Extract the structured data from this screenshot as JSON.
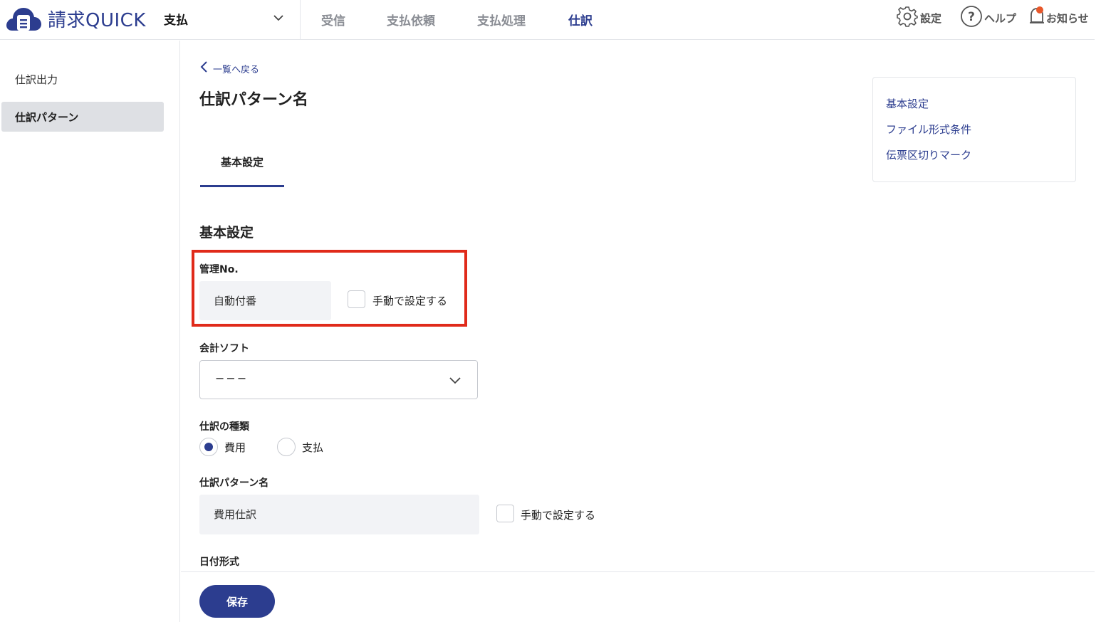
{
  "header": {
    "logo_text": "請求QUICK",
    "module": "支払",
    "nav": [
      {
        "label": "受信"
      },
      {
        "label": "支払依頼"
      },
      {
        "label": "支払処理"
      },
      {
        "label": "仕訳"
      }
    ],
    "settings_label": "設定",
    "help_label": "ヘルプ",
    "notice_label": "お知らせ"
  },
  "sidebar": {
    "items": [
      {
        "label": "仕訳出力"
      },
      {
        "label": "仕訳パターン"
      }
    ]
  },
  "main": {
    "back_label": "一覧へ戻る",
    "page_title": "仕訳パターン名",
    "tab_label": "基本設定",
    "section_title": "基本設定",
    "mgmt_no": {
      "label": "管理No.",
      "value": "自動付番",
      "checkbox_label": "手動で設定する"
    },
    "accounting_soft": {
      "label": "会計ソフト",
      "value": "−−−"
    },
    "journal_type": {
      "label": "仕訳の種類",
      "options": [
        {
          "label": "費用",
          "checked": true
        },
        {
          "label": "支払",
          "checked": false
        }
      ]
    },
    "pattern_name": {
      "label": "仕訳パターン名",
      "value": "費用仕訳",
      "checkbox_label": "手動で設定する"
    },
    "date_format": {
      "label": "日付形式"
    }
  },
  "anchors": [
    {
      "label": "基本設定"
    },
    {
      "label": "ファイル形式条件"
    },
    {
      "label": "伝票区切りマーク"
    }
  ],
  "footer": {
    "save_label": "保存"
  },
  "colors": {
    "brand": "#2c3d8f",
    "highlight": "#e02a1a",
    "notice_dot": "#e8572a"
  }
}
